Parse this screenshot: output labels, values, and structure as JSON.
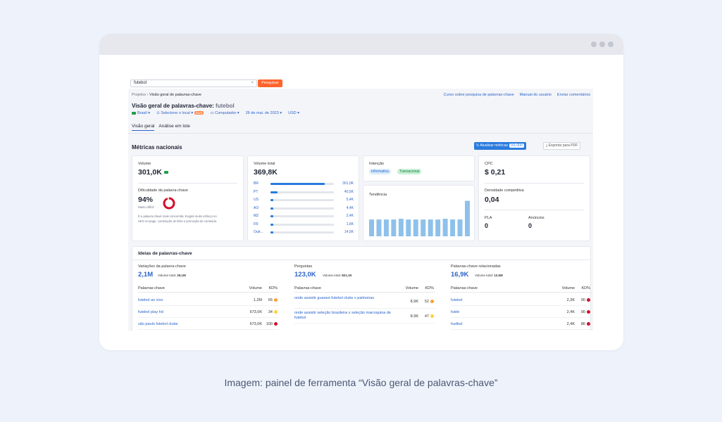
{
  "search": {
    "value": "futebol",
    "button": "Pesquisar"
  },
  "breadcrumb": {
    "root": "Projetos",
    "current": "Visão geral de palavras-chave"
  },
  "top_links": [
    "Curso sobre pesquisa de palavras-chave",
    "Manual do usuário",
    "Enviar comentários"
  ],
  "title": {
    "label": "Visão geral de palavras-chave:",
    "keyword": "futebol"
  },
  "filters": {
    "country": "Brasil",
    "location": "Selecione o local",
    "new_badge": "novo",
    "device": "Computador",
    "date": "26 de mai. de 2023",
    "currency": "USD"
  },
  "tabs": [
    "Visão geral",
    "Análise em lote"
  ],
  "section": {
    "title": "Métricas nacionais",
    "update_btn": "Atualizar métricas",
    "update_count": "0/1.000",
    "pdf_btn": "Exportar para PDF"
  },
  "volume": {
    "label": "Volume",
    "value": "301,0K"
  },
  "difficulty": {
    "label": "Dificuldade da palavra-chave",
    "value": "94%",
    "level": "Muito difícil",
    "desc1": "É a palavra-chave mais concorrida. Exigirá muito esforço no",
    "desc2": "SEO on-page, construção de links e promoção de conteúdo.",
    "percent": 94
  },
  "total_volume": {
    "label": "Volume total",
    "value": "369,8K",
    "rows": [
      {
        "cc": "BR",
        "val": "301,0K",
        "frac": 0.85
      },
      {
        "cc": "PT",
        "val": "40,5K",
        "frac": 0.11
      },
      {
        "cc": "US",
        "val": "5,4K",
        "frac": 0.02
      },
      {
        "cc": "AO",
        "val": "4,4K",
        "frac": 0.015
      },
      {
        "cc": "MZ",
        "val": "2,4K",
        "frac": 0.01
      },
      {
        "cc": "FR",
        "val": "1,6K",
        "frac": 0.008
      },
      {
        "cc": "Outr...",
        "val": "14,5K",
        "frac": 0.04
      }
    ]
  },
  "intent": {
    "label": "Intenção",
    "tags": [
      "Informativa",
      "Transacional"
    ]
  },
  "trend": {
    "label": "Tendência",
    "values": [
      0.46,
      0.46,
      0.46,
      0.46,
      0.48,
      0.46,
      0.46,
      0.46,
      0.46,
      0.46,
      0.48,
      0.46,
      0.46,
      0.97
    ]
  },
  "cpc": {
    "label": "CPC",
    "value": "$ 0,21"
  },
  "competition": {
    "label": "Densidade competitiva",
    "value": "0,04"
  },
  "pla": {
    "label": "PLA",
    "value": "0"
  },
  "ads": {
    "label": "Anúncios",
    "value": "0"
  },
  "ideas": {
    "title": "Ideias de palavras-chave",
    "col_kw": "Palavras-chave",
    "col_vol": "Volume",
    "col_kd": "KD%",
    "total_label": "Volume total:",
    "columns": [
      {
        "heading": "Variações da palavra-chave",
        "count": "2,1M",
        "total": "29,1M",
        "rows": [
          {
            "kw": "futebol ao vivo",
            "vol": "1,2M",
            "kd": "65",
            "color": "#ff9f2f"
          },
          {
            "kw": "futebol play hd",
            "vol": "673,0K",
            "kd": "34",
            "color": "#ffd23a"
          },
          {
            "kw": "são paulo futebol clube",
            "vol": "673,0K",
            "kd": "100",
            "color": "#d0112b"
          }
        ]
      },
      {
        "heading": "Perguntas",
        "count": "123,0K",
        "total": "821,1K",
        "rows": [
          {
            "kw": "onde assistir guarani futebol clube x palmeiras",
            "vol": "8,9K",
            "kd": "52",
            "color": "#ff9f2f"
          },
          {
            "kw": "onde assistir seleção brasileira x seleção marroquina de futebol",
            "vol": "8,9K",
            "kd": "47",
            "color": "#ffd23a"
          }
        ]
      },
      {
        "heading": "Palavras-chave relacionadas",
        "count": "16,9K",
        "total": "12,5M",
        "rows": [
          {
            "kw": "futebol",
            "vol": "2,3K",
            "kd": "90",
            "color": "#d0112b"
          },
          {
            "kw": "futeb",
            "vol": "2,4K",
            "kd": "90",
            "color": "#d0112b"
          },
          {
            "kw": "fuetbol",
            "vol": "2,4K",
            "kd": "86",
            "color": "#d0112b"
          }
        ]
      }
    ]
  },
  "help": "?",
  "caption": "Imagem: painel de ferramenta “Visão geral de palavras-chave”"
}
